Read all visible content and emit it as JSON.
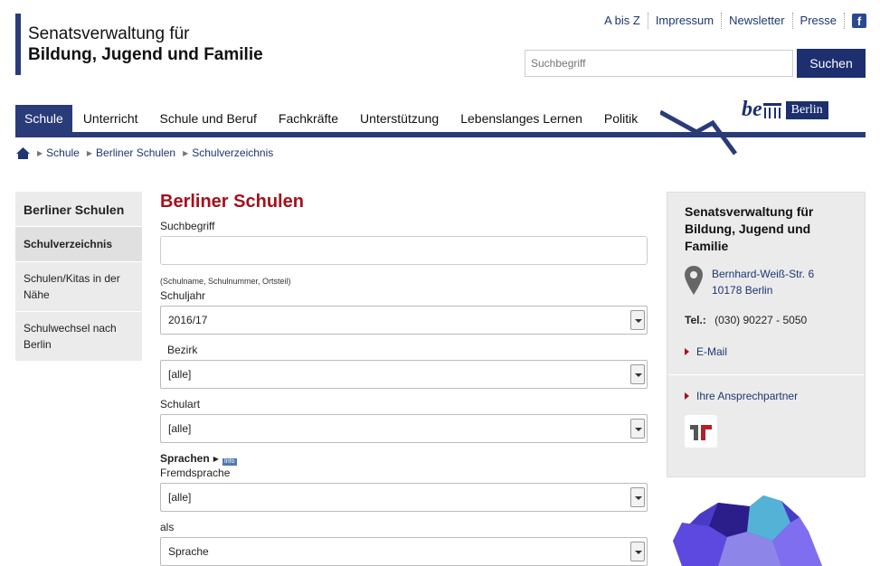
{
  "header": {
    "org_line1": "Senatsverwaltung für",
    "org_line2": "Bildung, Jugend und Familie",
    "service_links": [
      "A bis Z",
      "Impressum",
      "Newsletter",
      "Presse"
    ],
    "facebook_glyph": "f",
    "search_placeholder": "Suchbegriff",
    "search_button": "Suchen",
    "berlin_logo_be": "be",
    "berlin_logo_berlin": "Berlin"
  },
  "mainnav": [
    "Schule",
    "Unterricht",
    "Schule und Beruf",
    "Fachkräfte",
    "Unterstützung",
    "Lebenslanges Lernen",
    "Politik"
  ],
  "breadcrumb": [
    "Schule",
    "Berliner Schulen",
    "Schulverzeichnis"
  ],
  "leftnav": {
    "heading": "Berliner Schulen",
    "items": [
      "Schulverzeichnis",
      "Schulen/Kitas in der Nähe",
      "Schulwechsel nach Berlin"
    ]
  },
  "main": {
    "title": "Berliner Schulen",
    "suchbegriff_label": "Suchbegriff",
    "suchbegriff_hint": "(Schulname, Schulnummer, Ortsteil)",
    "schuljahr_label": "Schuljahr",
    "schuljahr_value": "2016/17",
    "bezirk_label": "Bezirk",
    "bezirk_value": "[alle]",
    "schulart_label": "Schulart",
    "schulart_value": "[alle]",
    "sprachen_label": "Sprachen",
    "info_badge": "Info",
    "fremdsprache_label": "Fremdsprache",
    "fremdsprache_value": "[alle]",
    "als_label": "als",
    "als_value": "Sprache"
  },
  "rightbox": {
    "title": "Senatsverwaltung für Bildung, Jugend und Familie",
    "street": "Bernhard-Weiß-Str. 6",
    "city": "10178 Berlin",
    "tel_label": "Tel.:",
    "tel_value": "(030) 90227 - 5050",
    "email_link": "E-Mail",
    "contact_link": "Ihre Ansprechpartner"
  },
  "colors": {
    "brand_blue": "#2a3b7a",
    "headline_red": "#a3101d"
  }
}
